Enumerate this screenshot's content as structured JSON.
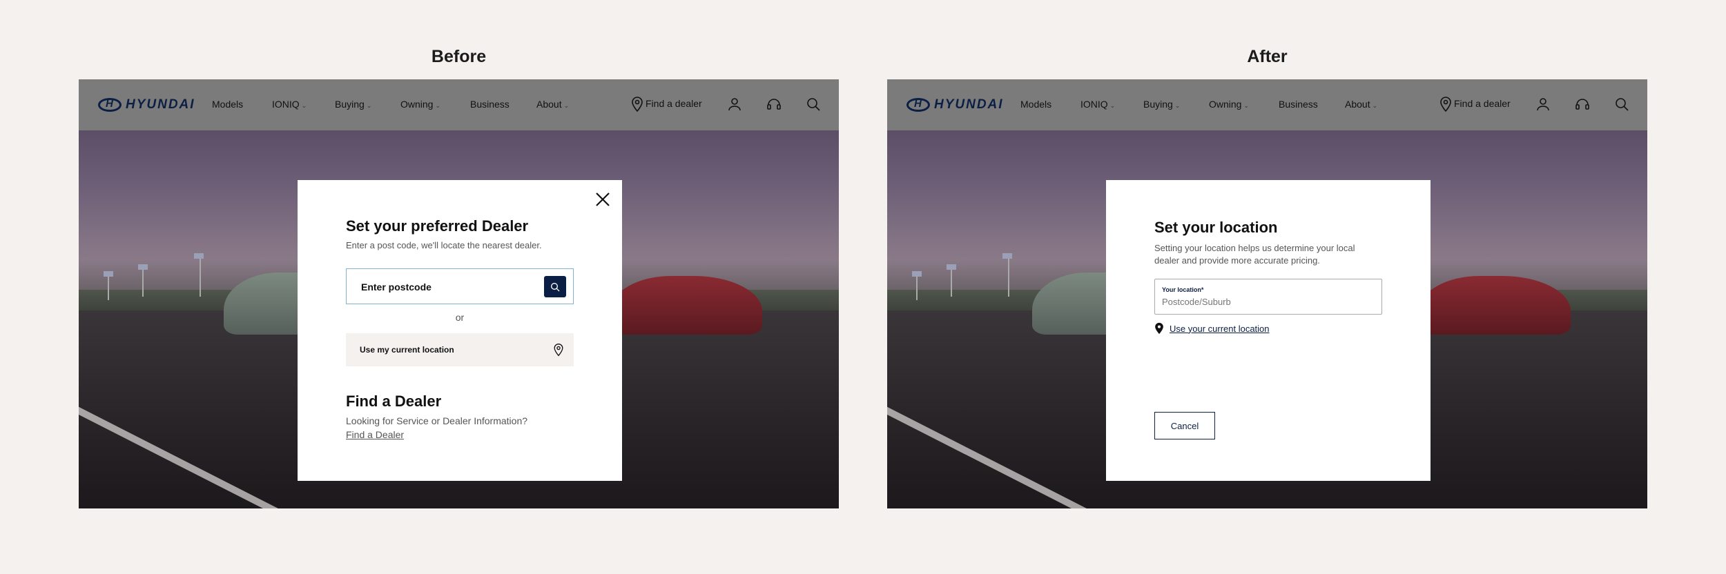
{
  "panels": {
    "before_label": "Before",
    "after_label": "After"
  },
  "nav": {
    "brand": "HYUNDAI",
    "items": [
      {
        "label": "Models",
        "has_caret": false
      },
      {
        "label": "IONIQ",
        "has_caret": true
      },
      {
        "label": "Buying",
        "has_caret": true
      },
      {
        "label": "Owning",
        "has_caret": true
      },
      {
        "label": "Business",
        "has_caret": false
      },
      {
        "label": "About",
        "has_caret": true
      }
    ],
    "find_dealer": "Find a dealer",
    "icons": [
      "map-pin-icon",
      "user-icon",
      "headset-icon",
      "search-icon"
    ]
  },
  "before_modal": {
    "title": "Set your preferred Dealer",
    "subtitle": "Enter a post code, we'll locate the nearest dealer.",
    "postcode_placeholder": "Enter postcode",
    "or_text": "or",
    "current_location": "Use my current location",
    "find_title": "Find a Dealer",
    "find_text": "Looking for Service or Dealer Information?",
    "find_link": "Find a Dealer"
  },
  "after_modal": {
    "title": "Set your location",
    "description": "Setting your location helps us determine your local dealer and provide more accurate pricing.",
    "field_label": "Your location*",
    "field_placeholder": "Postcode/Suburb",
    "use_location": "Use your current location",
    "cancel": "Cancel"
  },
  "colors": {
    "brand_navy": "#0b1f44",
    "page_bg": "#f5f1ef",
    "nav_bg": "#7b7b7b"
  }
}
